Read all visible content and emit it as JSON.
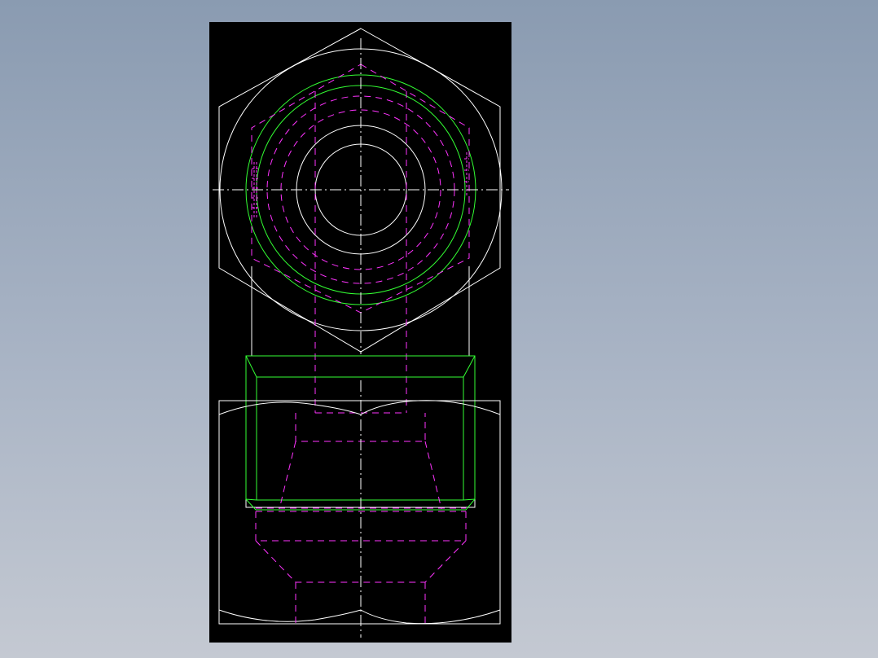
{
  "viewport": {
    "background": "#000000",
    "colors": {
      "outline": "#ffffff",
      "hidden": "#ff33ff",
      "thread": "#33ff33",
      "centerline": "#ffffff"
    }
  },
  "drawing": {
    "description_views": [
      "top-view",
      "front-view"
    ]
  }
}
